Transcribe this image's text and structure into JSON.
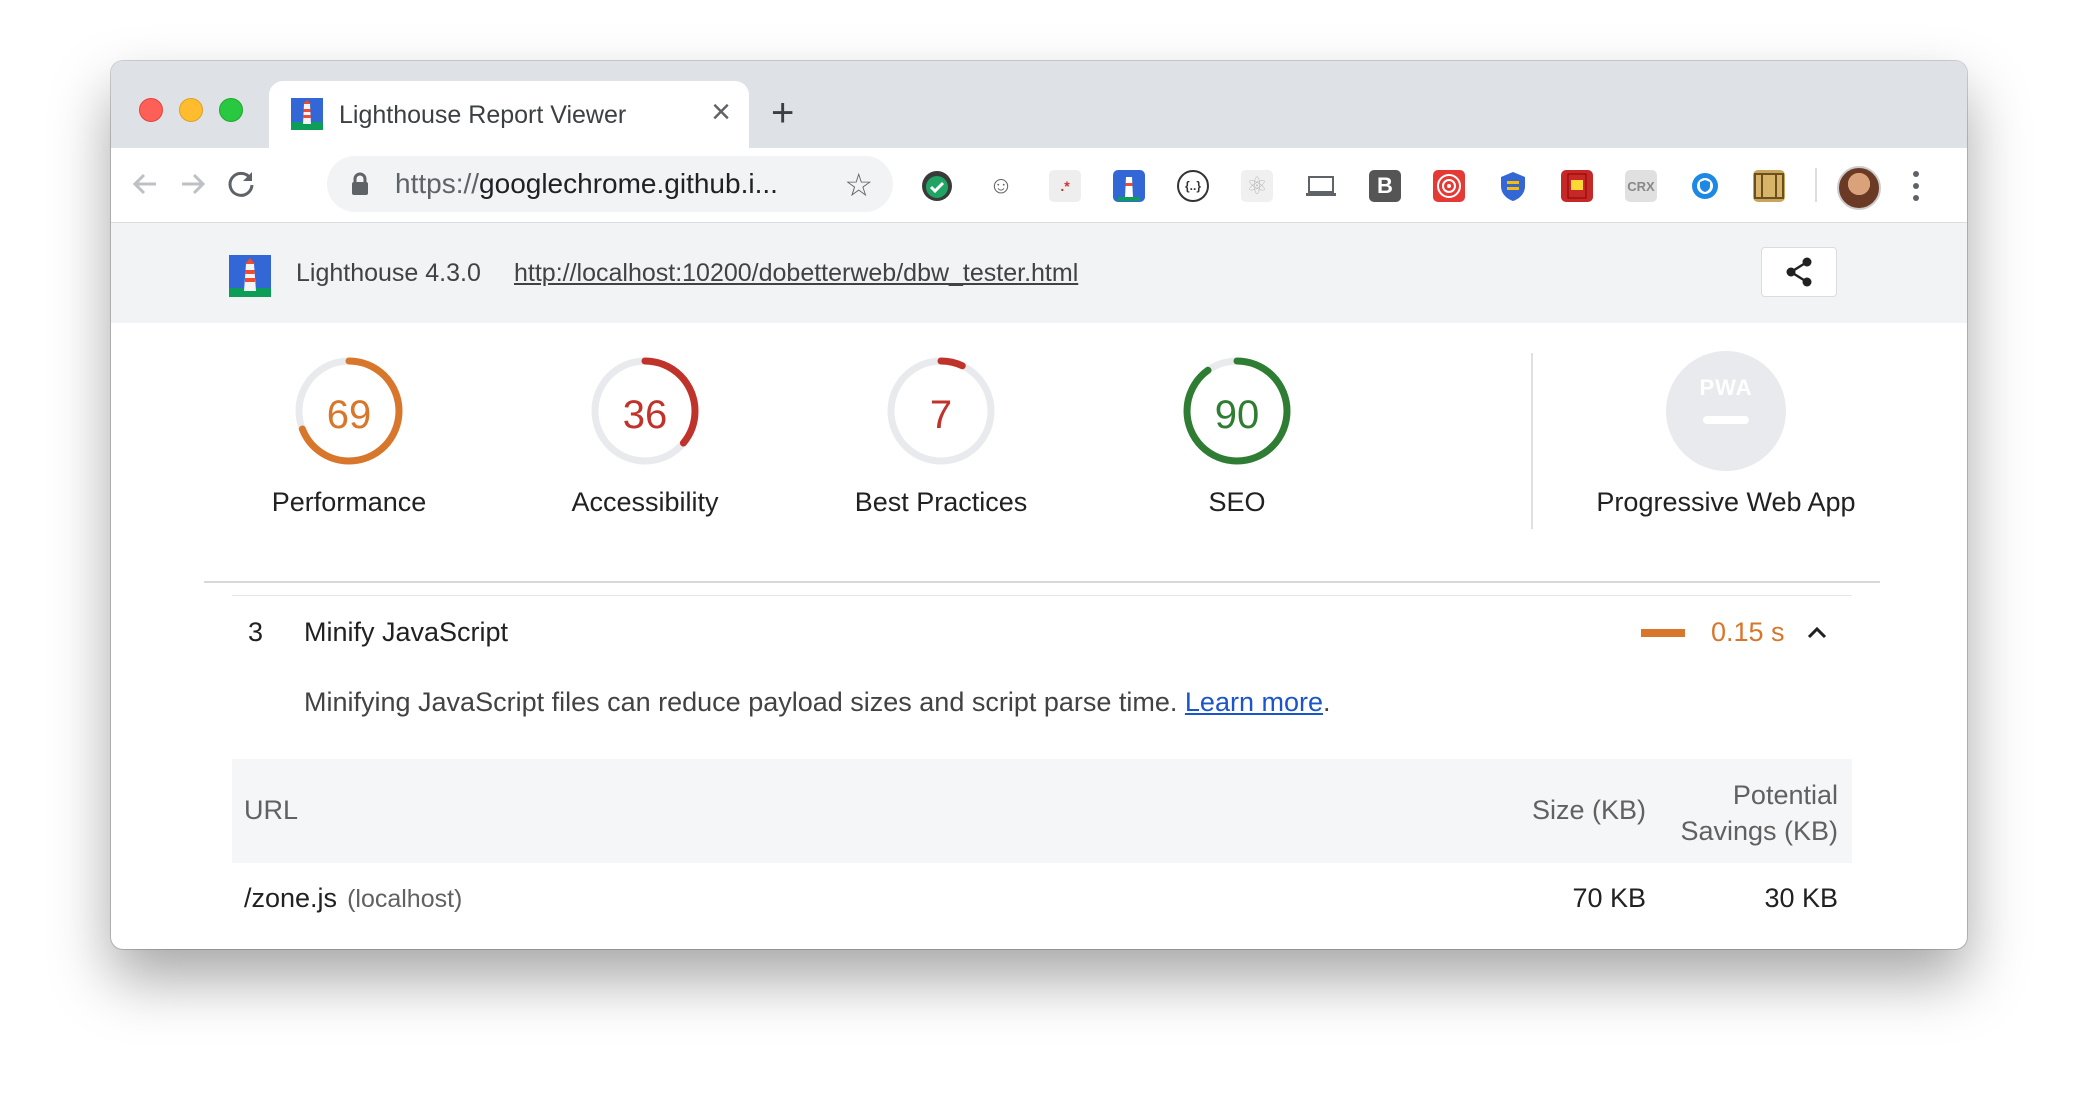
{
  "browser": {
    "tab_title": "Lighthouse Report Viewer",
    "url_scheme": "https://",
    "url_host": "googlechrome.github.i...",
    "extensions": [
      "check-shield-ext",
      "ghost-ext",
      "regex-ext",
      "lighthouse-ext",
      "json-ext",
      "react-ext",
      "device-ext",
      "bold-b-ext",
      "target-ext",
      "shield-ext",
      "memory-card-ext",
      "CRX",
      "privacy-ext",
      "film-ext"
    ]
  },
  "report": {
    "version": "Lighthouse 4.3.0",
    "tested_url": "http://localhost:10200/dobetterweb/dbw_tester.html"
  },
  "gauges": [
    {
      "label": "Performance",
      "score": "69",
      "value": 69,
      "color": "#d8762b"
    },
    {
      "label": "Accessibility",
      "score": "36",
      "value": 36,
      "color": "#c0332b"
    },
    {
      "label": "Best Practices",
      "score": "7",
      "value": 7,
      "color": "#c0332b"
    },
    {
      "label": "SEO",
      "score": "90",
      "value": 90,
      "color": "#2e7d32"
    }
  ],
  "pwa": {
    "badge": "PWA",
    "label": "Progressive Web App"
  },
  "audit": {
    "index": "3",
    "title": "Minify JavaScript",
    "value": "0.15 s",
    "description": "Minifying JavaScript files can reduce payload sizes and script parse time. ",
    "learn_more": "Learn more",
    "desc_end": ".",
    "table": {
      "col_url": "URL",
      "col_size": "Size (KB)",
      "col_savings_1": "Potential",
      "col_savings_2": "Savings (KB)",
      "rows": [
        {
          "url": "/zone.js",
          "host": "(localhost)",
          "size": "70 KB",
          "savings": "30 KB"
        }
      ]
    }
  }
}
